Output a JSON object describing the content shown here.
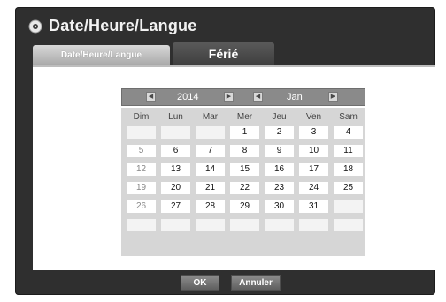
{
  "window": {
    "title": "Date/Heure/Langue",
    "icon": "settings-globe-icon"
  },
  "tabs": [
    {
      "label": "Date/Heure/Langue",
      "active": true
    },
    {
      "label": "Férié",
      "active": false
    }
  ],
  "calendar": {
    "year": "2014",
    "month": "Jan",
    "weekdays": [
      "Dim",
      "Lun",
      "Mar",
      "Mer",
      "Jeu",
      "Ven",
      "Sam"
    ],
    "weeks": [
      [
        "",
        "",
        "",
        "1",
        "2",
        "3",
        "4"
      ],
      [
        "5",
        "6",
        "7",
        "8",
        "9",
        "10",
        "11"
      ],
      [
        "12",
        "13",
        "14",
        "15",
        "16",
        "17",
        "18"
      ],
      [
        "19",
        "20",
        "21",
        "22",
        "23",
        "24",
        "25"
      ],
      [
        "26",
        "27",
        "28",
        "29",
        "30",
        "31",
        ""
      ],
      [
        "",
        "",
        "",
        "",
        "",
        "",
        ""
      ]
    ]
  },
  "buttons": {
    "ok": "OK",
    "cancel": "Annuler"
  },
  "colors": {
    "window_bg": "#2f2f2f",
    "calendar_bg": "#d6d6d6",
    "header_bg": "#8a8a8a"
  }
}
